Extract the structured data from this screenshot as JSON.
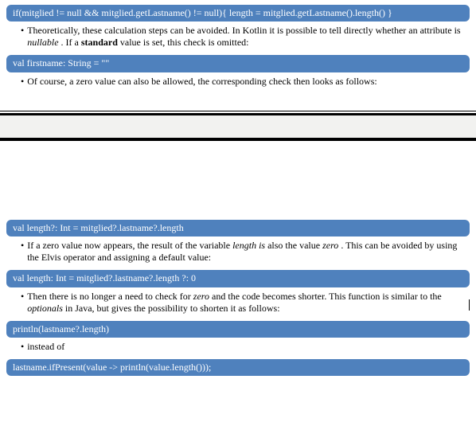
{
  "blocks": {
    "code1": "if(mitglied != null && mitglied.getLastname() != null){ length = mitglied.getLastname().length() }",
    "para1_a": "Theoretically, these calculation steps can be avoided. In Kotlin it is possible to tell directly whether an attribute is ",
    "para1_b": "nullable",
    "para1_c": ". If a ",
    "para1_d": "standard",
    "para1_e": " value is set, this check is omitted:",
    "code2": "val firstname: String = \"\"",
    "para2": "Of course, a zero value can also be allowed, the corresponding check then looks as follows:",
    "code3": "val length?: Int = mitglied?.lastname?.length",
    "para3_a": "If a zero value now appears, the result of the variable ",
    "para3_b": "length is",
    "para3_c": " also the value ",
    "para3_d": "zero",
    "para3_e": " . This can be avoided by using the Elvis operator and assigning a default value:",
    "code4": "val length: Int = mitglied?.lastname?.length ?: 0",
    "para4_a": "Then there is no longer a need to check for ",
    "para4_b": "zero",
    "para4_c": " and the code becomes shorter. This function is similar to the ",
    "para4_d": "optionals",
    "para4_e": " in Java, but gives the possibility to shorten it as follows:",
    "code5": "println(lastname?.length)",
    "para5": "instead of",
    "code6": "lastname.ifPresent(value -> println(value.length()));"
  }
}
